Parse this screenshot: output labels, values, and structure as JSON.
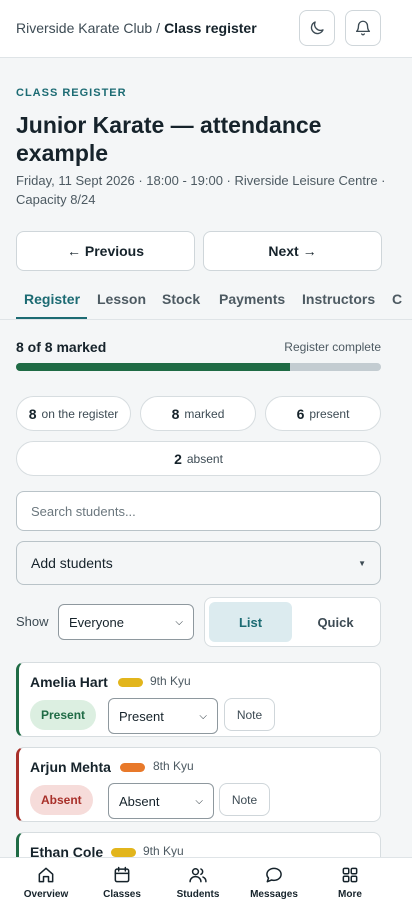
{
  "breadcrumb": {
    "parent": "Riverside Karate Club",
    "separator": "/",
    "current": "Class register"
  },
  "header": {
    "theme_icon": "moon-icon",
    "notify_icon": "bell-icon"
  },
  "page": {
    "eyebrow": "CLASS REGISTER",
    "title": "Junior Karate — attendance example",
    "meta": "Friday, 11 Sept 2026 · 18:00 - 19:00 · Riverside Leisure Centre · Capacity 8/24"
  },
  "pager": {
    "previous": "← Previous",
    "next": "Next →"
  },
  "tabs": [
    {
      "label": "Register",
      "active": true
    },
    {
      "label": "Lesson"
    },
    {
      "label": "Stock"
    },
    {
      "label": "Payments"
    },
    {
      "label": "Instructors"
    },
    {
      "label": "C"
    }
  ],
  "progress": {
    "label": "8 of 8 marked",
    "status": "Register complete",
    "fill_fraction": 0.75
  },
  "stats": [
    {
      "value": "8",
      "label": "on the register"
    },
    {
      "value": "8",
      "label": "marked"
    },
    {
      "value": "6",
      "label": "present"
    },
    {
      "value": "2",
      "label": "absent"
    }
  ],
  "search": {
    "placeholder": "Search students..."
  },
  "add_students": {
    "label": "Add students"
  },
  "filter": {
    "label": "Show",
    "value": "Everyone"
  },
  "view_toggle": {
    "list": "List",
    "quick": "Quick",
    "active": "list"
  },
  "students": [
    {
      "name": "Amelia Hart",
      "grade": "9th Kyu",
      "belt_color": "#e2b51c",
      "status": "Present",
      "select_value": "Present",
      "note": "Note"
    },
    {
      "name": "Arjun Mehta",
      "grade": "8th Kyu",
      "belt_color": "#e8792a",
      "status": "Absent",
      "select_value": "Absent",
      "note": "Note"
    },
    {
      "name": "Ethan Cole",
      "grade": "9th Kyu",
      "belt_color": "#e2b51c"
    }
  ],
  "bottom_nav": [
    {
      "label": "Overview",
      "icon": "home-icon"
    },
    {
      "label": "Classes",
      "icon": "calendar-icon"
    },
    {
      "label": "Students",
      "icon": "users-icon"
    },
    {
      "label": "Messages",
      "icon": "chat-icon"
    },
    {
      "label": "More",
      "icon": "grid-icon"
    }
  ],
  "colors": {
    "accent": "#1c6b73",
    "present_bg": "#dcefe1",
    "present_fg": "#1f6b45",
    "present_border": "#1f6b45",
    "absent_bg": "#f6dcda",
    "absent_fg": "#a8302a",
    "absent_border": "#a8302a",
    "progress_fill": "#1f6b45"
  }
}
